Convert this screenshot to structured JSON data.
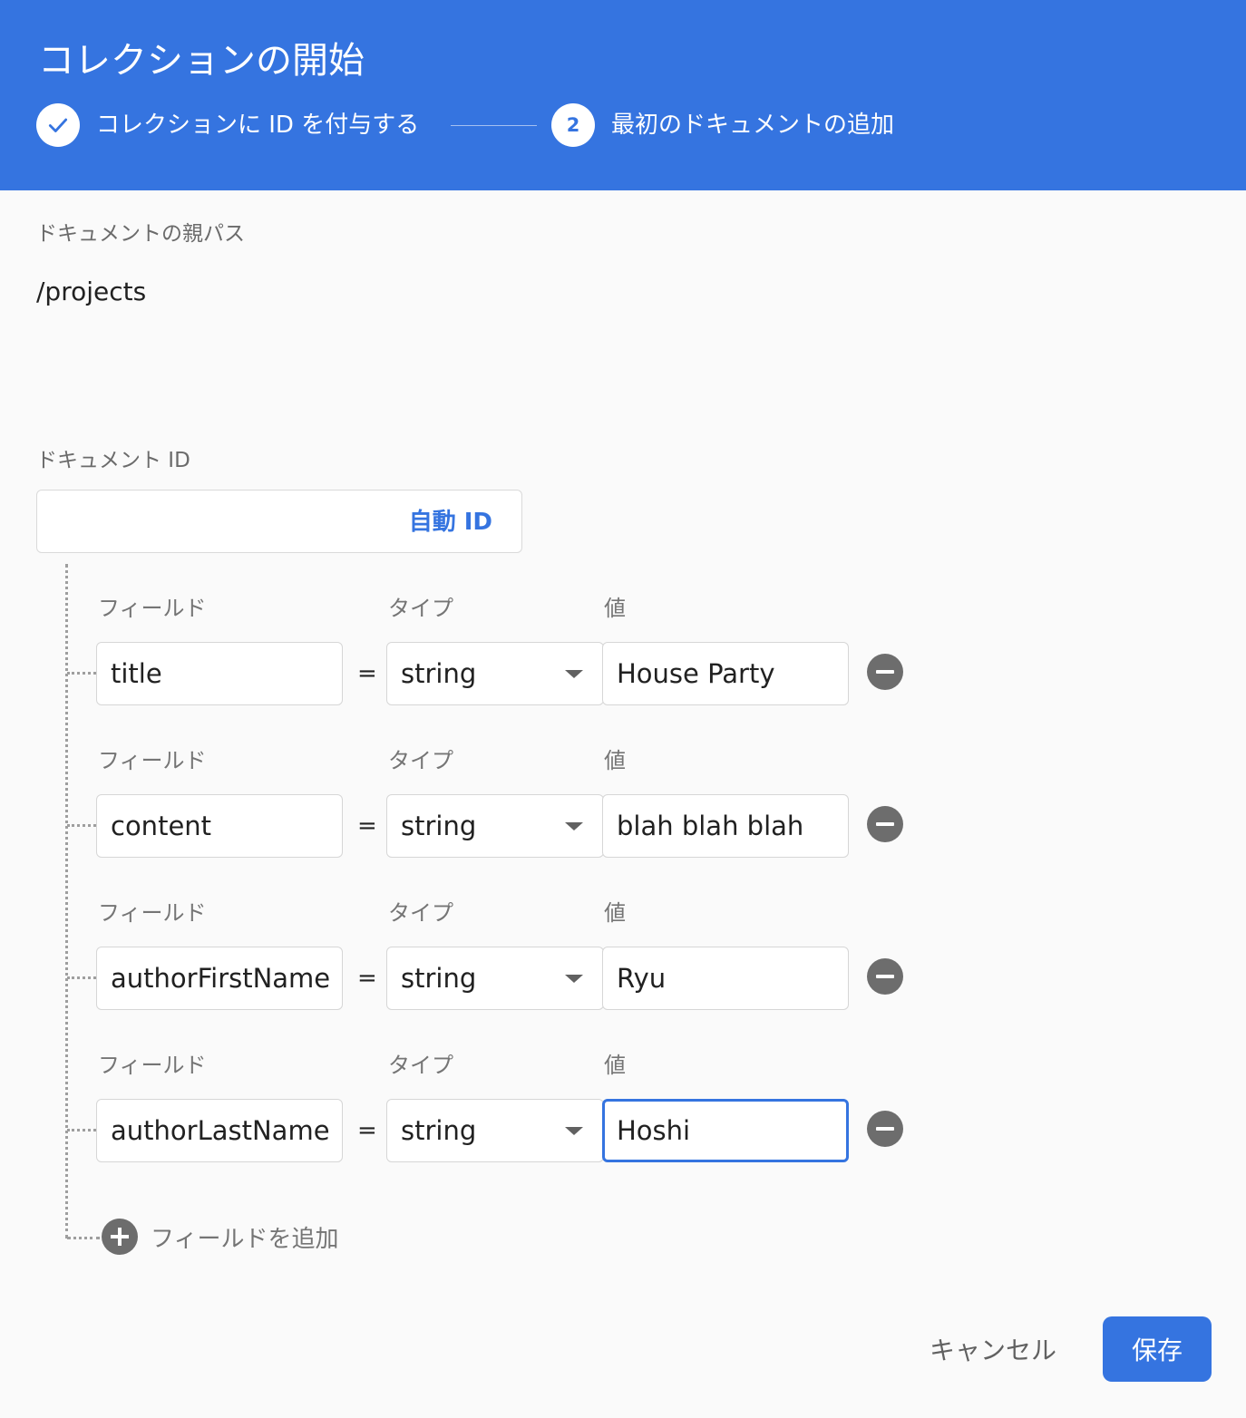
{
  "dialog": {
    "title": "コレクションの開始",
    "steps": [
      {
        "label": "コレクションに ID を付与する",
        "state": "done"
      },
      {
        "number": "2",
        "label": "最初のドキュメントの追加",
        "state": "active"
      }
    ]
  },
  "parent_path": {
    "label": "ドキュメントの親パス",
    "value": "/projects"
  },
  "document_id": {
    "label": "ドキュメント ID",
    "value": "",
    "auto_id_label": "自動 ID"
  },
  "field_headers": {
    "field": "フィールド",
    "type": "タイプ",
    "value": "値",
    "equals": "="
  },
  "fields": [
    {
      "name": "title",
      "type": "string",
      "value": "House Party"
    },
    {
      "name": "content",
      "type": "string",
      "value": "blah blah blah"
    },
    {
      "name": "authorFirstName",
      "type": "string",
      "value": "Ryu"
    },
    {
      "name": "authorLastName",
      "type": "string",
      "value": "Hoshi",
      "focused": true
    }
  ],
  "add_field_label": "フィールドを追加",
  "actions": {
    "cancel": "キャンセル",
    "save": "保存"
  },
  "colors": {
    "primary": "#3574e0",
    "icon_gray": "#6d6d6d"
  }
}
